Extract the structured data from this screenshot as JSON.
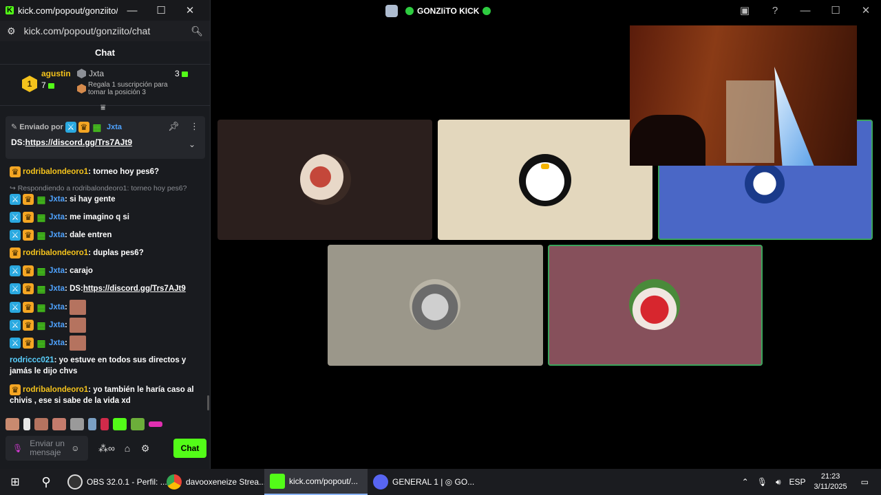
{
  "chat_window": {
    "title": "kick.com/popout/gonziito/c...",
    "url": "kick.com/popout/gonziito/chat",
    "header": "Chat",
    "leaderboard": {
      "first": {
        "rank": "1",
        "name": "agustin",
        "count": "7"
      },
      "second": {
        "name": "Jxta",
        "count": "3"
      },
      "third_text": "Regala 1 suscripción para tomar la posición 3"
    },
    "pinned": {
      "sent_by": "Enviado por",
      "user": "Jxta",
      "prefix": "DS:",
      "link": "https://discord.gg/Trs7AJt9"
    },
    "messages": [
      {
        "user": "rodribalondeoro1",
        "text": "torneo hoy pes6?"
      },
      {
        "reply": "Respondiendo a rodribalondeoro1: torneo hoy pes6?"
      },
      {
        "user": "Jxta",
        "text": "si hay gente"
      },
      {
        "user": "Jxta",
        "text": "me imagino q si"
      },
      {
        "user": "Jxta",
        "text": "dale entren"
      },
      {
        "user": "rodribalondeoro1",
        "text": "duplas pes6?"
      },
      {
        "user": "Jxta",
        "text": "carajo"
      },
      {
        "user": "Jxta",
        "prefix": "DS:",
        "link": "https://discord.gg/Trs7AJt9"
      },
      {
        "user": "Jxta",
        "text": ""
      },
      {
        "user": "Jxta",
        "text": ""
      },
      {
        "user": "Jxta",
        "text": ""
      },
      {
        "user": "rodriccc021",
        "text": "yo estuve en todos sus directos y",
        "text2": "jamás le dijo chvs"
      },
      {
        "user": "rodribalondeoro1",
        "text": "yo también le haría caso al",
        "text2": "chivis , ese si sabe de la vida xd"
      }
    ],
    "input_placeholder": "Enviar un mensaje",
    "chat_button": "Chat"
  },
  "call": {
    "title": "GONZIiTO KICK"
  },
  "taskbar": {
    "items": [
      {
        "label": "OBS 32.0.1 - Perfil: ..."
      },
      {
        "label": "davooxeneize Strea..."
      },
      {
        "label": "kick.com/popout/..."
      },
      {
        "label": "GENERAL 1 | ◎ GO..."
      }
    ],
    "lang": "ESP",
    "time": "21:23",
    "date": "3/11/2025"
  },
  "colors": {
    "kick_green": "#53fc18",
    "speaking": "#3ba55c",
    "crown": "#f5a623",
    "mod": "#2aa9e0"
  }
}
